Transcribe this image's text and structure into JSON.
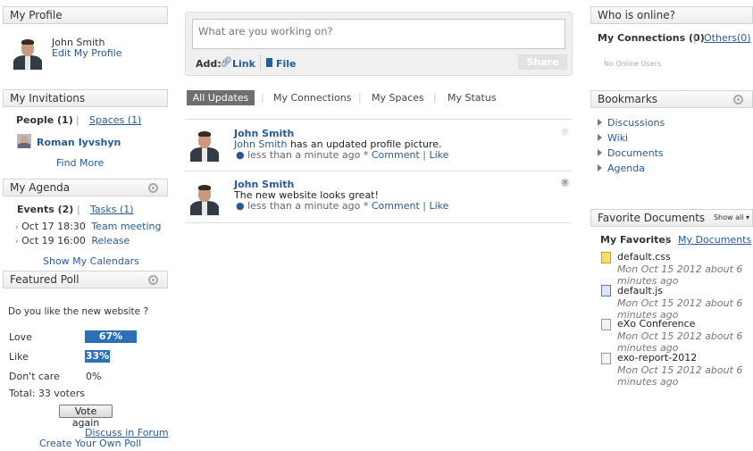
{
  "profile": {
    "title": "My Profile",
    "name": "John Smith",
    "edit_link": "Edit My Profile"
  },
  "invitations": {
    "title": "My Invitations",
    "people_tab": "People (1)",
    "spaces_tab": "Spaces (1)",
    "person": "Roman Iyvshyn",
    "find_more": "Find More"
  },
  "agenda": {
    "title": "My Agenda",
    "events_tab": "Events (2)",
    "tasks_tab": "Tasks (1)",
    "events": [
      {
        "date": "Oct 17 18:30",
        "title": "Team meeting"
      },
      {
        "date": "Oct 19 16:00",
        "title": "Release"
      }
    ],
    "show_calendars": "Show My Calendars"
  },
  "poll": {
    "title": "Featured Poll",
    "question": "Do you like the new website ?",
    "options": [
      {
        "label": "Love",
        "percent_text": "67%",
        "fraction": 0.67
      },
      {
        "label": "Like",
        "percent_text": "33%",
        "fraction": 0.33
      },
      {
        "label": "Don't care",
        "percent_text": "0%",
        "fraction": 0
      }
    ],
    "total": "Total: 33 voters",
    "vote_button": "Vote again",
    "discuss_link": "Discuss in Forum",
    "create_link": "Create Your Own Poll"
  },
  "composer": {
    "placeholder": "What are you working on?",
    "add_label": "Add:",
    "link_label": "Link",
    "file_label": "File",
    "share_button": "Share"
  },
  "stream_tabs": [
    "All Updates",
    "My Connections",
    "My Spaces",
    "My Status"
  ],
  "activities": [
    {
      "author": "John Smith",
      "text_author": "John Smith",
      "text": "has an updated profile picture.",
      "time": "less than a minute ago",
      "sep": "*",
      "comment": "Comment",
      "pipe": "|",
      "like": "Like"
    },
    {
      "author": "John Smith",
      "text_author": "",
      "text": "The new website looks great!",
      "time": "less than a minute ago",
      "sep": "*",
      "comment": "Comment",
      "pipe": "|",
      "like": "Like"
    }
  ],
  "online": {
    "title": "Who is online?",
    "connections_tab": "My Connections (0)",
    "others_tab": "Others(0)",
    "empty": "No Online Users"
  },
  "bookmarks": {
    "title": "Bookmarks",
    "items": [
      "Discussions",
      "Wiki",
      "Documents",
      "Agenda"
    ]
  },
  "favorites": {
    "title": "Favorite Documents",
    "show_all": "Show all",
    "favorites_tab": "My Favorites",
    "documents_tab": "My Documents",
    "docs": [
      {
        "name": "default.css",
        "date_line1": "Mon Oct 15 2012 about 6",
        "date_line2": "minutes ago"
      },
      {
        "name": "default.js",
        "date_line1": "Mon Oct 15 2012 about 6",
        "date_line2": "minutes ago"
      },
      {
        "name": "eXo Conference",
        "date_line1": "Mon Oct 15 2012 about 6",
        "date_line2": "minutes ago"
      },
      {
        "name": "exo-report-2012",
        "date_line1": "Mon Oct 15 2012 about 6",
        "date_line2": "minutes ago"
      }
    ]
  },
  "colors": {
    "accent": "#2a5a96",
    "poll_bar": "#2d6fb6",
    "active_tab": "#6e6e6e"
  }
}
